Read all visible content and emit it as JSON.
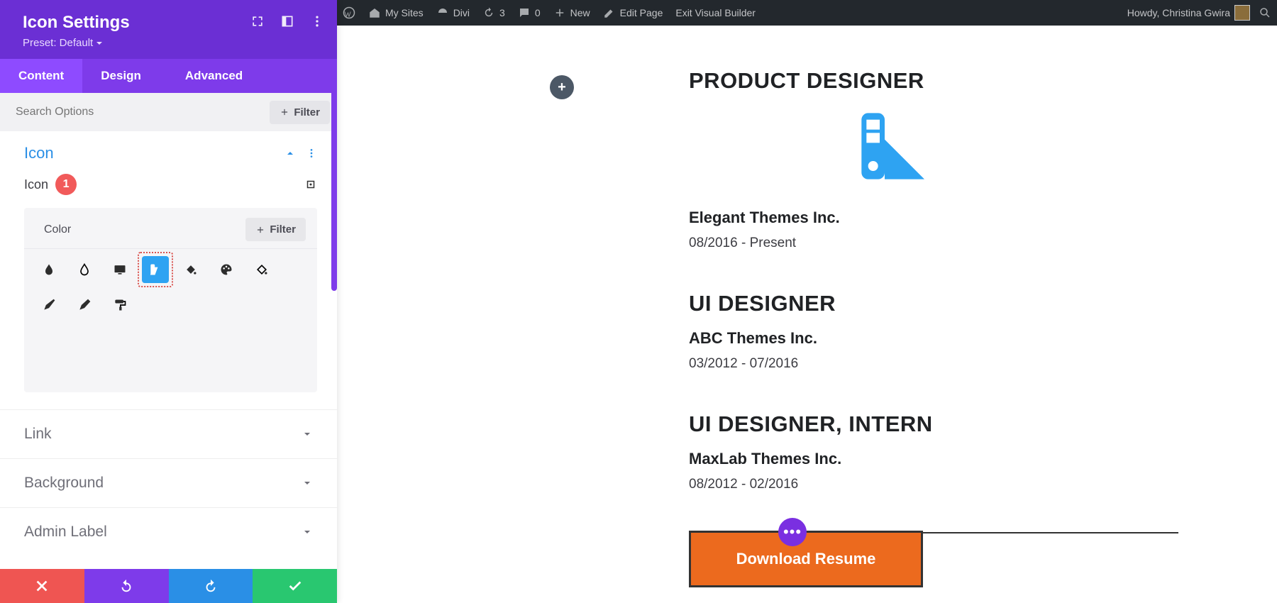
{
  "adminBar": {
    "mySites": "My Sites",
    "divi": "Divi",
    "updates": "3",
    "comments": "0",
    "new": "New",
    "editPage": "Edit Page",
    "exitVb": "Exit Visual Builder",
    "howdy": "Howdy, Christina Gwira"
  },
  "panel": {
    "title": "Icon Settings",
    "preset": "Preset: Default",
    "tabs": {
      "content": "Content",
      "design": "Design",
      "advanced": "Advanced"
    },
    "searchPlaceholder": "Search Options",
    "filter": "Filter",
    "section": {
      "iconHeading": "Icon",
      "iconLabel": "Icon",
      "annotation": "1",
      "colorLabel": "Color"
    },
    "accordions": {
      "link": "Link",
      "background": "Background",
      "adminLabel": "Admin Label"
    },
    "iconNames": [
      "tint",
      "fill-drip",
      "computer",
      "swatch",
      "paint-bucket",
      "palette",
      "roller-alt",
      "brush",
      "brush-alt",
      "paint-roller"
    ]
  },
  "preview": {
    "jobs": [
      {
        "title": "PRODUCT DESIGNER",
        "company": "Elegant Themes Inc.",
        "dates": "08/2016 - Present",
        "showIcon": true
      },
      {
        "title": "UI DESIGNER",
        "company": "ABC Themes Inc.",
        "dates": "03/2012 - 07/2016",
        "showIcon": false
      },
      {
        "title": "UI DESIGNER, INTERN",
        "company": "MaxLab Themes Inc.",
        "dates": "08/2012 - 02/2016",
        "showIcon": false
      }
    ],
    "downloadLabel": "Download Resume"
  }
}
